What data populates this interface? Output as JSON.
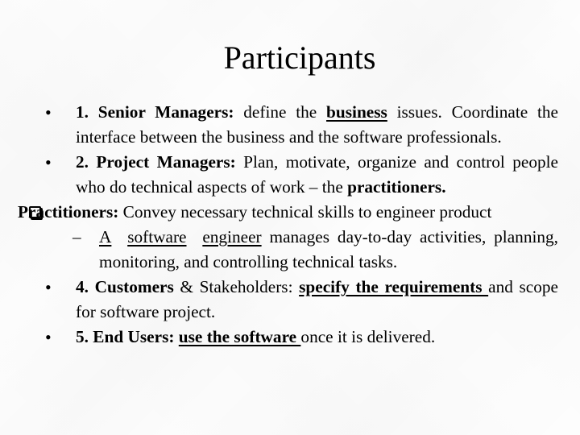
{
  "slide": {
    "title": "Participants",
    "items": [
      {
        "marker": "bullet",
        "marker_glyph": "•",
        "label": "1. Senior Managers:",
        "text_before": " define the ",
        "underlined": "business",
        "text_after": " issues. Coordinate the interface between the business and the software professionals."
      },
      {
        "marker": "bullet",
        "marker_glyph": "•",
        "label": "2. Project Managers:",
        "text_before": " Plan, motivate, organize and control people who do technical aspects of work – the ",
        "bold_end": "practitioners."
      },
      {
        "marker": "checkbox",
        "label": "Practitioners:",
        "text_before": " Convey necessary technical skills to engineer product",
        "sub_item": {
          "marker_glyph": "–",
          "underlined_words": [
            "A",
            "software",
            "engineer"
          ],
          "text_after": " manages  day-to-day activities, planning, monitoring,  and controlling technical tasks."
        }
      },
      {
        "marker": "bullet",
        "marker_glyph": "•",
        "label": "4. Customers",
        "text_mid": " & Stakeholders:",
        "underlined_bold": "specify the requirements ",
        "text_after": "and scope for software project."
      },
      {
        "marker": "bullet",
        "marker_glyph": "•",
        "label": "5. End Users:",
        "underlined_bold": "use the software ",
        "text_after": "once it is delivered."
      }
    ]
  }
}
